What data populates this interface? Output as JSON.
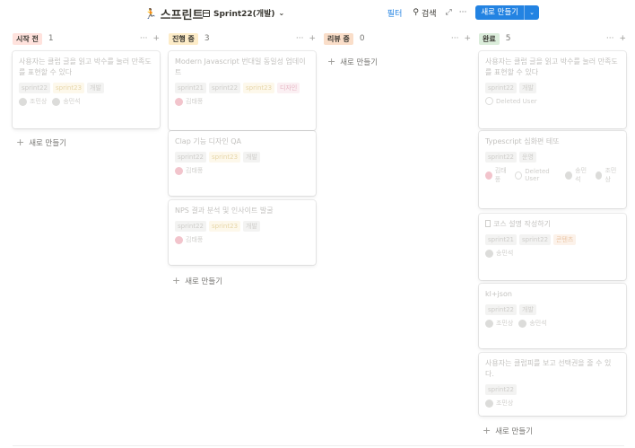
{
  "header": {
    "emoji": "🏃",
    "title": "스프린트",
    "view_label": "Sprint22(개발)",
    "filter_label": "필터",
    "search_label": "검색",
    "new_label": "새로 만들기",
    "more": "···"
  },
  "columns": [
    {
      "name": "시작 전",
      "count": "1",
      "color": "#ffe2dd",
      "cards": [
        {
          "title": "사용자는 클럽 글을 읽고 박수를 눌러 만족도를 표현할 수 있다",
          "tags": [
            [
              "sprint22",
              "gray"
            ],
            [
              "sprint23",
              "yellow"
            ],
            [
              "개발",
              "gray"
            ]
          ],
          "people": [
            [
              "조민상",
              "gray"
            ],
            [
              "송민석",
              "gray"
            ]
          ]
        }
      ],
      "new_label": "새로 만들기"
    },
    {
      "name": "진행 중",
      "count": "3",
      "color": "#fdecc8",
      "cards": [
        {
          "title": "Modern Javascript 번대일 동일성 업데이트",
          "tags": [
            [
              "sprint21",
              "gray"
            ],
            [
              "sprint22",
              "gray"
            ],
            [
              "sprint23",
              "yellow"
            ],
            [
              "디자인",
              "pink"
            ]
          ],
          "people": [
            [
              "김태풍",
              "pink"
            ]
          ]
        },
        {
          "title": "Clap 기능 디자인 QA",
          "tags": [
            [
              "sprint22",
              "gray"
            ],
            [
              "sprint23",
              "yellow"
            ],
            [
              "개발",
              "gray"
            ]
          ],
          "people": [
            [
              "김태풍",
              "pink"
            ]
          ]
        },
        {
          "title": "NPS 결과 분석 및 인사이트 발굴",
          "tags": [
            [
              "sprint22",
              "gray"
            ],
            [
              "sprint23",
              "yellow"
            ],
            [
              "개발",
              "gray"
            ]
          ],
          "people": [
            [
              "김태풍",
              "pink"
            ]
          ]
        }
      ],
      "new_label": "새로 만들기"
    },
    {
      "name": "리뷰 중",
      "count": "0",
      "color": "#fadec9",
      "cards": [],
      "new_label": "새로 만들기"
    },
    {
      "name": "완료",
      "count": "5",
      "color": "#dbeddb",
      "cards": [
        {
          "title": "사용자는 클럽 글을 읽고 박수를 눌러 만족도를 표현할 수 있다",
          "tags": [
            [
              "sprint22",
              "gray"
            ],
            [
              "개발",
              "gray"
            ]
          ],
          "people": [
            [
              "Deleted User",
              "del"
            ]
          ]
        },
        {
          "title": "Typescript 심화편 테또",
          "tags": [
            [
              "sprint22",
              "gray"
            ],
            [
              "운영",
              "gray"
            ]
          ],
          "people": [
            [
              "김태풍",
              "pink"
            ],
            [
              "Deleted User",
              "del"
            ],
            [
              "송민석",
              "gray"
            ],
            [
              "조민상",
              "gray"
            ]
          ]
        },
        {
          "title": "코스 설명 작성하기",
          "doc": true,
          "tags": [
            [
              "sprint21",
              "gray"
            ],
            [
              "sprint22",
              "gray"
            ],
            [
              "콘텐츠",
              "orange"
            ]
          ],
          "people": [
            [
              "송민석",
              "gray"
            ]
          ]
        },
        {
          "title": "kl+json",
          "tags": [
            [
              "sprint22",
              "gray"
            ],
            [
              "개발",
              "gray"
            ]
          ],
          "people": [
            [
              "조민상",
              "gray"
            ],
            [
              "송민석",
              "gray"
            ]
          ]
        },
        {
          "title": "사용자는 클럽피를 보고 선택권을 줄 수 있다.",
          "tags": [
            [
              "sprint22",
              "gray"
            ]
          ],
          "people": [
            [
              "조민상",
              "gray"
            ]
          ]
        }
      ],
      "new_label": "새로 만들기"
    }
  ]
}
